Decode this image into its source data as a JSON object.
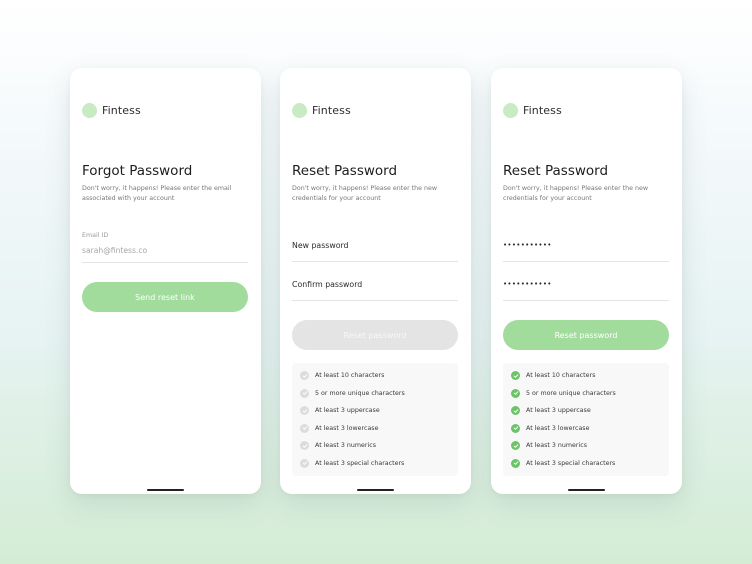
{
  "brand": {
    "name": "Fintess",
    "logo_color": "#c8ebc4"
  },
  "colors": {
    "accent_green": "#a2dc9d",
    "check_green": "#6cc468",
    "disabled_gray": "#e4e4e4"
  },
  "forgot": {
    "title": "Forgot Password",
    "subtitle": "Don't worry, it happens! Please enter the email associated with your account",
    "email_label": "Email ID",
    "email_value": "sarah@fintess.co",
    "button": "Send reset link"
  },
  "reset_empty": {
    "title": "Reset Password",
    "subtitle": "Don't worry, it happens! Please enter the new credentials for your account",
    "new_password_placeholder": "New password",
    "confirm_password_placeholder": "Confirm password",
    "button": "Reset password",
    "button_state": "disabled",
    "requirements": [
      {
        "label": "At least 10 characters",
        "met": false
      },
      {
        "label": "5 or more unique characters",
        "met": false
      },
      {
        "label": "At least 3 uppercase",
        "met": false
      },
      {
        "label": "At least 3 lowercase",
        "met": false
      },
      {
        "label": "At least 3 numerics",
        "met": false
      },
      {
        "label": "At least 3 special characters",
        "met": false
      }
    ]
  },
  "reset_filled": {
    "title": "Reset Password",
    "subtitle": "Don't worry, it happens! Please enter the new credentials for your account",
    "new_password_value": "•••••••••••",
    "confirm_password_value": "•••••••••••",
    "button": "Reset password",
    "button_state": "enabled",
    "requirements": [
      {
        "label": "At least 10 characters",
        "met": true
      },
      {
        "label": "5 or more unique characters",
        "met": true
      },
      {
        "label": "At least 3 uppercase",
        "met": true
      },
      {
        "label": "At least 3 lowercase",
        "met": true
      },
      {
        "label": "At least 3 numerics",
        "met": true
      },
      {
        "label": "At least 3 special characters",
        "met": true
      }
    ]
  }
}
